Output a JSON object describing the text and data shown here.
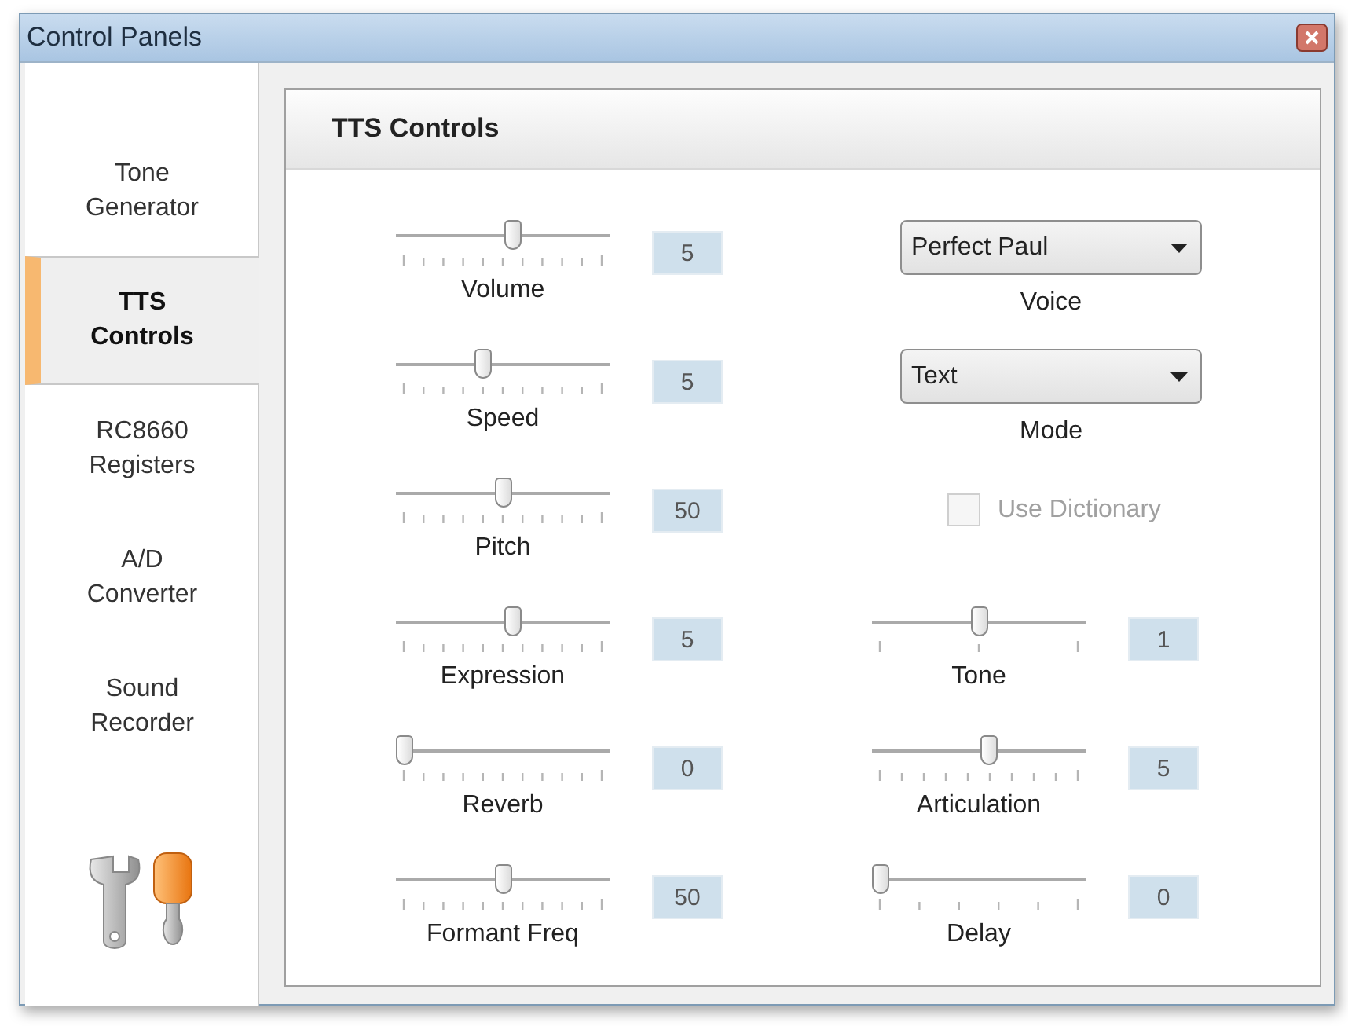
{
  "window": {
    "title": "Control Panels"
  },
  "sidebar": {
    "items": [
      {
        "label": "Tone\nGenerator",
        "selected": false
      },
      {
        "label": "TTS\nControls",
        "selected": true
      },
      {
        "label": "RC8660\nRegisters",
        "selected": false
      },
      {
        "label": "A/D\nConverter",
        "selected": false
      },
      {
        "label": "Sound\nRecorder",
        "selected": false
      }
    ]
  },
  "panel": {
    "title": "TTS Controls",
    "sliders_left": [
      {
        "label": "Volume",
        "level": 0.55,
        "value": "5"
      },
      {
        "label": "Speed",
        "level": 0.4,
        "value": "5"
      },
      {
        "label": "Pitch",
        "level": 0.5,
        "value": "50"
      },
      {
        "label": "Expression",
        "level": 0.55,
        "value": "5"
      },
      {
        "label": "Reverb",
        "level": 0,
        "value": "0"
      },
      {
        "label": "Formant Freq",
        "level": 0.5,
        "value": "50"
      }
    ],
    "voice": {
      "value": "Perfect Paul",
      "label": "Voice"
    },
    "mode": {
      "value": "Text",
      "label": "Mode"
    },
    "use_dictionary": {
      "label": "Use Dictionary",
      "checked": false,
      "disabled": true
    },
    "sliders_right": [
      {
        "label": "Tone",
        "level": 0.5,
        "value": "1"
      },
      {
        "label": "Articulation",
        "level": 0.55,
        "value": "5"
      },
      {
        "label": "Delay",
        "level": 0,
        "value": "0"
      }
    ]
  }
}
